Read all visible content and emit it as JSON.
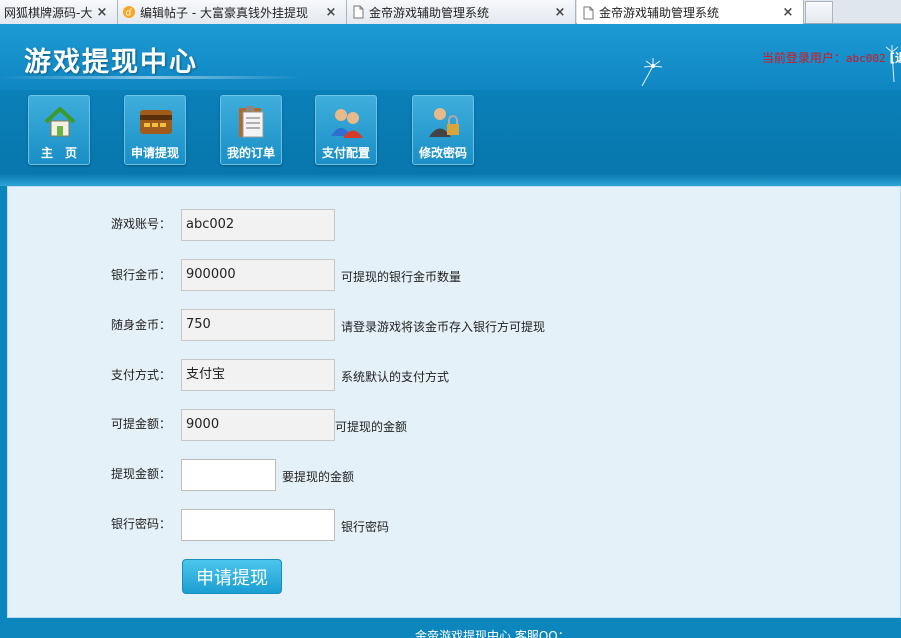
{
  "browser": {
    "tabs": [
      {
        "title": "网狐棋牌源码-大",
        "close": "×"
      },
      {
        "title": "编辑帖子 - 大富豪真钱外挂提现",
        "close": "×"
      },
      {
        "title": "金帝游戏辅助管理系统",
        "close": "×"
      },
      {
        "title": "金帝游戏辅助管理系统",
        "close": "×"
      }
    ]
  },
  "header": {
    "title": "游戏提现中心",
    "login_prefix": "当前登录用户：",
    "username": "abc002",
    "extra": "[退"
  },
  "nav": {
    "items": [
      {
        "label": "主　页",
        "icon": "home-icon"
      },
      {
        "label": "申请提现",
        "icon": "bankcard-icon"
      },
      {
        "label": "我的订单",
        "icon": "clipboard-icon"
      },
      {
        "label": "支付配置",
        "icon": "users-icon"
      },
      {
        "label": "修改密码",
        "icon": "user-lock-icon"
      }
    ]
  },
  "form": {
    "account_label": "游戏账号：",
    "account_value": "abc002",
    "bank_gold_label": "银行金币：",
    "bank_gold_value": "900000",
    "bank_gold_hint": "可提现的银行金币数量",
    "carry_gold_label": "随身金币：",
    "carry_gold_value": "750",
    "carry_gold_hint": "请登录游戏将该金币存入银行方可提现",
    "pay_method_label": "支付方式：",
    "pay_method_value": "支付宝",
    "pay_method_hint": "系统默认的支付方式",
    "available_label": "可提金额：",
    "available_value": "9000",
    "available_hint": "可提现的金额",
    "withdraw_label": "提现金额：",
    "withdraw_value": "",
    "withdraw_hint": "要提现的金额",
    "bank_pwd_label": "银行密码：",
    "bank_pwd_value": "",
    "bank_pwd_hint": "银行密码",
    "submit_label": "申请提现"
  },
  "footer": {
    "text": "金帝游戏提现中心 客服QQ："
  },
  "colors": {
    "header_blue": "#1d9ad4",
    "nav_blue": "#0a80b8",
    "panel_bg": "#e4f1f8",
    "user_red": "#d8141d",
    "button_blue": "#1b9ed3"
  }
}
